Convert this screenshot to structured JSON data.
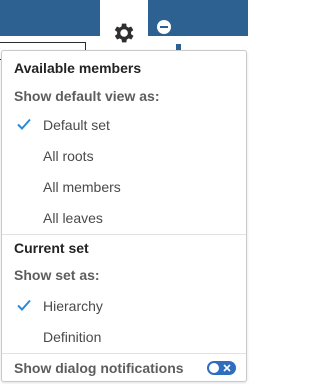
{
  "menu": {
    "section1": {
      "title": "Available members",
      "subtitle": "Show default view as:",
      "items": [
        {
          "label": "Default set",
          "checked": true
        },
        {
          "label": "All roots",
          "checked": false
        },
        {
          "label": "All members",
          "checked": false
        },
        {
          "label": "All leaves",
          "checked": false
        }
      ]
    },
    "section2": {
      "title": "Current set",
      "subtitle": "Show set as:",
      "items": [
        {
          "label": "Hierarchy",
          "checked": true
        },
        {
          "label": "Definition",
          "checked": false
        }
      ]
    },
    "footer": {
      "label": "Show dialog notifications",
      "toggle_on": false
    }
  },
  "icons": {
    "settings": "gear-icon",
    "collapse": "minus-circle-icon",
    "check": "checkmark-icon",
    "toggle_close": "close-icon"
  },
  "colors": {
    "accent": "#2f6dbf",
    "header": "#2d6192",
    "check": "#2b8ad8"
  }
}
